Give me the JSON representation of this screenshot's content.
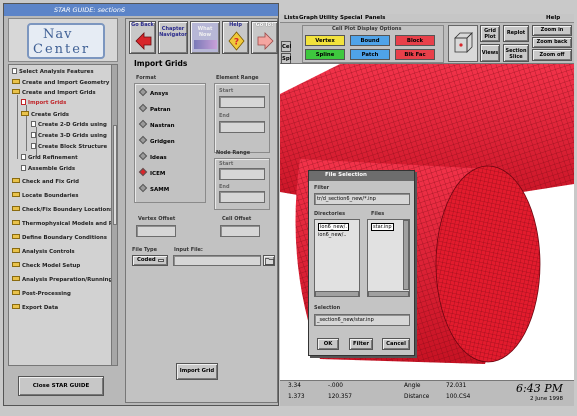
{
  "guide": {
    "window_title": "STAR GUIDE: section6",
    "logo": {
      "line1": "Nav",
      "line2": "Center"
    },
    "toolbar": {
      "go_back": "Go Back",
      "chapter_navigator": "Chapter Navigator",
      "what_now": "What Now",
      "help": "Help",
      "go_to": "Go To!"
    },
    "tree_items": [
      "Select Analysis Features",
      "Create and Import Geometry",
      "Create and Import Grids",
      "Import Grids",
      "Create Grids",
      "Create 2-D Grids using",
      "Create 3-D Grids using",
      "Create Block Structure",
      "Grid Refinement",
      "Assemble Grids",
      "Check and Fix Grid",
      "Locate Boundaries",
      "Check/Fix Boundary Locations",
      "Thermophysical Models and P",
      "Define Boundary Conditions",
      "Analysis Controls",
      "Check Model Setup",
      "Analysis Preparation/Running",
      "Post-Processing",
      "Export Data"
    ],
    "close_label": "Close STAR GUIDE",
    "page_title": "Import Grids",
    "format_label": "Format",
    "formats": [
      "Ansys",
      "Patran",
      "Nastran",
      "Gridgen",
      "Ideas",
      "ICEM",
      "SAMM"
    ],
    "selected_format": "ICEM",
    "element_range_label": "Element Range",
    "node_range_label": "Node Range",
    "start_label": "Start",
    "end_label": "End",
    "vertex_offset_label": "Vertex Offset",
    "cell_offset_label": "Cell Offset",
    "file_type_label": "File Type",
    "input_file_label": "Input File:",
    "file_type_value": "Coded",
    "import_button": "Import Grid"
  },
  "viewer": {
    "menus": [
      "Lists",
      "Graph",
      "Utility",
      "Special",
      "Panels",
      "Help"
    ],
    "cell_plot_title": "Cell Plot Display Options",
    "display_options": [
      {
        "label": "Vertex",
        "color": "#f2e23c"
      },
      {
        "label": "Bound",
        "color": "#4fa3e8"
      },
      {
        "label": "Block",
        "color": "#e8404a"
      },
      {
        "label": "Spline",
        "color": "#3ec83e"
      },
      {
        "label": "Patch",
        "color": "#4fa3e8"
      },
      {
        "label": "Blk Fac",
        "color": "#e8404a"
      }
    ],
    "left_tool": [
      "Cel",
      "Spl"
    ],
    "grid_plot": "Grid Plot",
    "views": "Views",
    "replot": "Replot",
    "section_slice": "Section Slice",
    "zoom_in": "Zoom in",
    "zoom_back": "Zoom back",
    "zoom_off": "Zoom off",
    "status": {
      "c1_top": "3.34",
      "c2_top": "-.000",
      "angle_label": "Angle",
      "angle_value": "72.031",
      "c1_bot": "1.373",
      "c2_bot": "120.357",
      "distance_label": "Distance",
      "distance_value": "100.CS4",
      "time": "6:43 PM",
      "date": "2 June 1998"
    },
    "mesh_color": "#e21b2d"
  },
  "file_dialog": {
    "title": "File Selection",
    "filter_label": "Filter",
    "filter_value": "tr/d_section6_new/*.inp",
    "directories_label": "Directories",
    "files_label": "Files",
    "directories": [
      "ion6_new/.",
      "ion6_new/.."
    ],
    "files": [
      "star.inp"
    ],
    "selection_label": "Selection",
    "selection_value": "_section6_new/star.inp",
    "ok": "OK",
    "filter_button": "Filter",
    "cancel": "Cancel"
  }
}
